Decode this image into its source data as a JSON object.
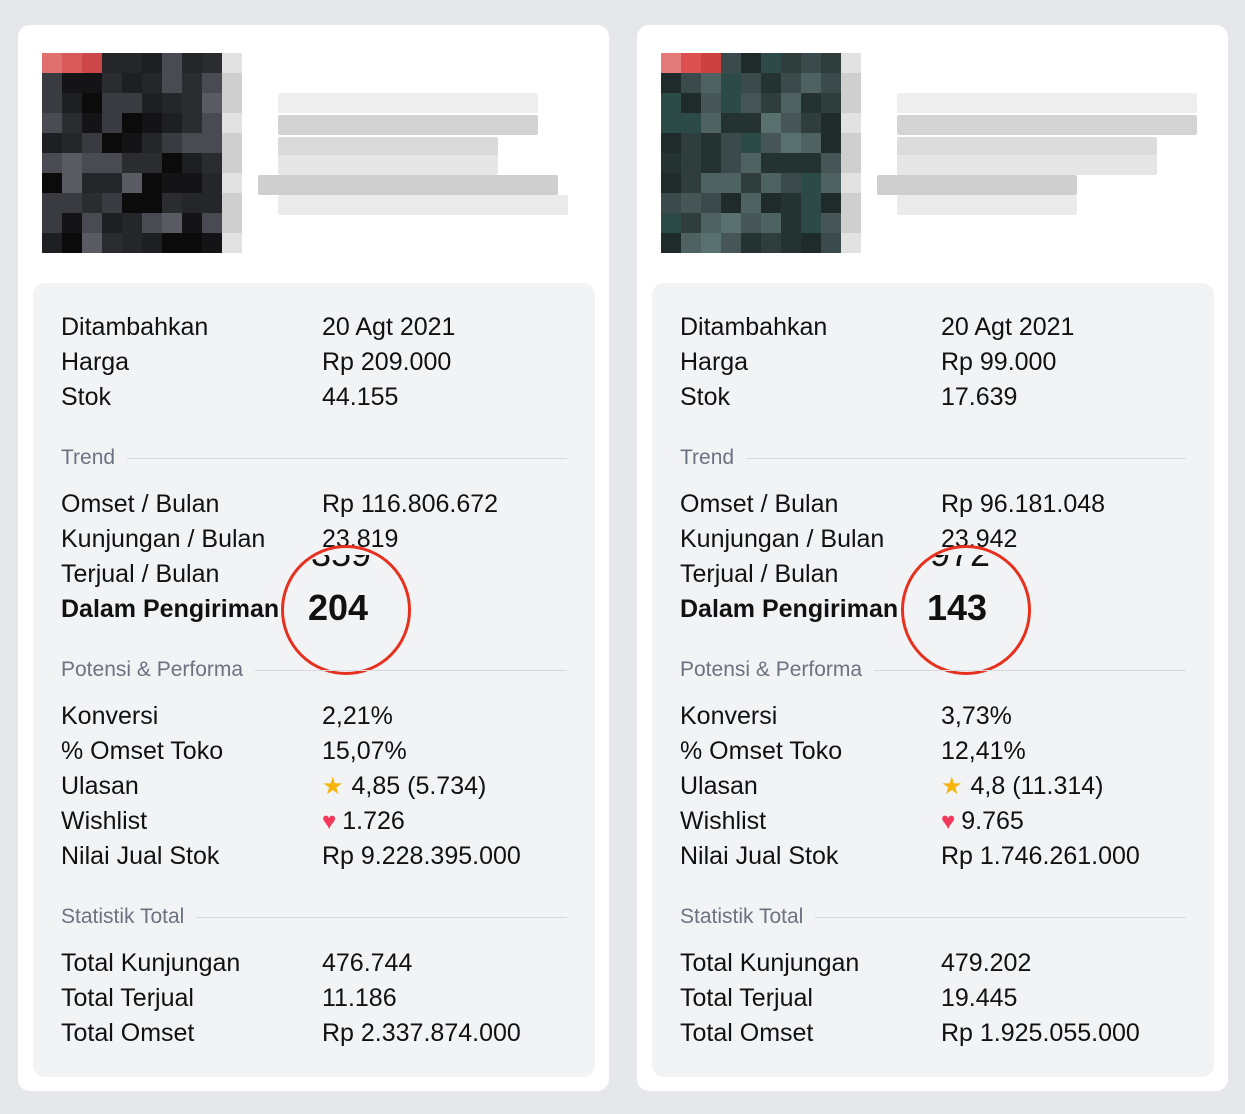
{
  "cards": [
    {
      "details": [
        {
          "label": "Ditambahkan",
          "value": "20 Agt 2021"
        },
        {
          "label": "Harga",
          "value": "Rp 209.000"
        },
        {
          "label": "Stok",
          "value": "44.155"
        }
      ],
      "trend_title": "Trend",
      "trend": [
        {
          "label": "Omset / Bulan",
          "value": "Rp 116.806.672"
        },
        {
          "label": "Kunjungan / Bulan",
          "value": "23.819"
        },
        {
          "label": "Terjual / Bulan",
          "value": "359"
        },
        {
          "label": "Dalam Pengiriman",
          "value": "204"
        }
      ],
      "performa_title": "Potensi & Performa",
      "performa": [
        {
          "label": "Konversi",
          "value": "2,21%"
        },
        {
          "label": "% Omset Toko",
          "value": "15,07%"
        },
        {
          "label": "Ulasan",
          "value": "4,85 (5.734)",
          "icon": "star-icon"
        },
        {
          "label": "Wishlist",
          "value": "1.726",
          "icon": "heart-icon"
        },
        {
          "label": "Nilai Jual Stok",
          "value": "Rp 9.228.395.000"
        }
      ],
      "statistik_title": "Statistik Total",
      "statistik": [
        {
          "label": "Total Kunjungan",
          "value": "476.744"
        },
        {
          "label": "Total Terjual",
          "value": "11.186"
        },
        {
          "label": "Total Omset",
          "value": "Rp 2.337.874.000"
        }
      ]
    },
    {
      "details": [
        {
          "label": "Ditambahkan",
          "value": "20 Agt 2021"
        },
        {
          "label": "Harga",
          "value": "Rp 99.000"
        },
        {
          "label": "Stok",
          "value": "17.639"
        }
      ],
      "trend_title": "Trend",
      "trend": [
        {
          "label": "Omset / Bulan",
          "value": "Rp 96.181.048"
        },
        {
          "label": "Kunjungan / Bulan",
          "value": "23.942"
        },
        {
          "label": "Terjual / Bulan",
          "value": "972"
        },
        {
          "label": "Dalam Pengiriman",
          "value": "143"
        }
      ],
      "performa_title": "Potensi & Performa",
      "performa": [
        {
          "label": "Konversi",
          "value": "3,73%"
        },
        {
          "label": "% Omset Toko",
          "value": "12,41%"
        },
        {
          "label": "Ulasan",
          "value": "4,8 (11.314)",
          "icon": "star-icon"
        },
        {
          "label": "Wishlist",
          "value": "9.765",
          "icon": "heart-icon"
        },
        {
          "label": "Nilai Jual Stok",
          "value": "Rp 1.746.261.000"
        }
      ],
      "statistik_title": "Statistik Total",
      "statistik": [
        {
          "label": "Total Kunjungan",
          "value": "479.202"
        },
        {
          "label": "Total Terjual",
          "value": "19.445"
        },
        {
          "label": "Total Omset",
          "value": "Rp 1.925.055.000"
        }
      ]
    }
  ],
  "colors": {
    "highlight_circle": "#e8301e",
    "star": "#f5b50a",
    "heart": "#f4385a",
    "section_text": "#6b7280"
  }
}
